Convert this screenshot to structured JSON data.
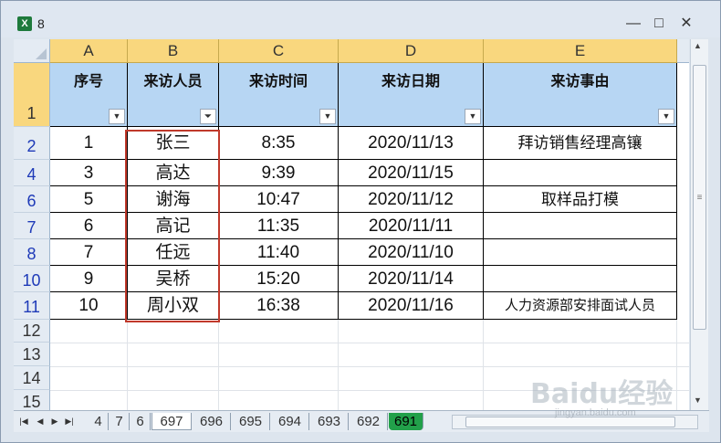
{
  "window": {
    "app_icon": "excel-icon",
    "title": "8",
    "minimize": "—",
    "restore": "□",
    "close": "✕"
  },
  "columns": [
    "A",
    "B",
    "C",
    "D",
    "E"
  ],
  "header_row": {
    "row_label": "1",
    "fields": [
      "序号",
      "来访人员",
      "来访时间",
      "来访日期",
      "来访事由"
    ],
    "dropdown_glyph": "▼",
    "filter_glyph": "⏷"
  },
  "rows": [
    {
      "row_label": "2",
      "values": [
        "1",
        "张三",
        "8:35",
        "2020/11/13",
        "拜访销售经理高镶"
      ]
    },
    {
      "row_label": "4",
      "values": [
        "3",
        "高达",
        "9:39",
        "2020/11/15",
        ""
      ]
    },
    {
      "row_label": "6",
      "values": [
        "5",
        "谢海",
        "10:47",
        "2020/11/12",
        "取样品打模"
      ]
    },
    {
      "row_label": "7",
      "values": [
        "6",
        "高记",
        "11:35",
        "2020/11/11",
        ""
      ]
    },
    {
      "row_label": "8",
      "values": [
        "7",
        "任远",
        "11:40",
        "2020/11/10",
        ""
      ]
    },
    {
      "row_label": "10",
      "values": [
        "9",
        "吴桥",
        "15:20",
        "2020/11/14",
        ""
      ]
    },
    {
      "row_label": "11",
      "values": [
        "10",
        "周小双",
        "16:38",
        "2020/11/16",
        "人力资源部安排面试人员"
      ]
    }
  ],
  "empty_rows": [
    "12",
    "13",
    "14",
    "15"
  ],
  "sheet_tabs": [
    "4",
    "7",
    "6",
    "697",
    "696",
    "695",
    "694",
    "693",
    "692",
    "691"
  ],
  "active_tab": "697",
  "highlight_tab": "691",
  "watermark": {
    "logo": "Baidu经验",
    "url": "jingyan.baidu.com"
  },
  "colors": {
    "header_fill": "#b7d6f3",
    "selected_col_header": "#f9d77e",
    "filter_row_number": "#1e3ab8",
    "highlight_box": "#c0392b"
  }
}
